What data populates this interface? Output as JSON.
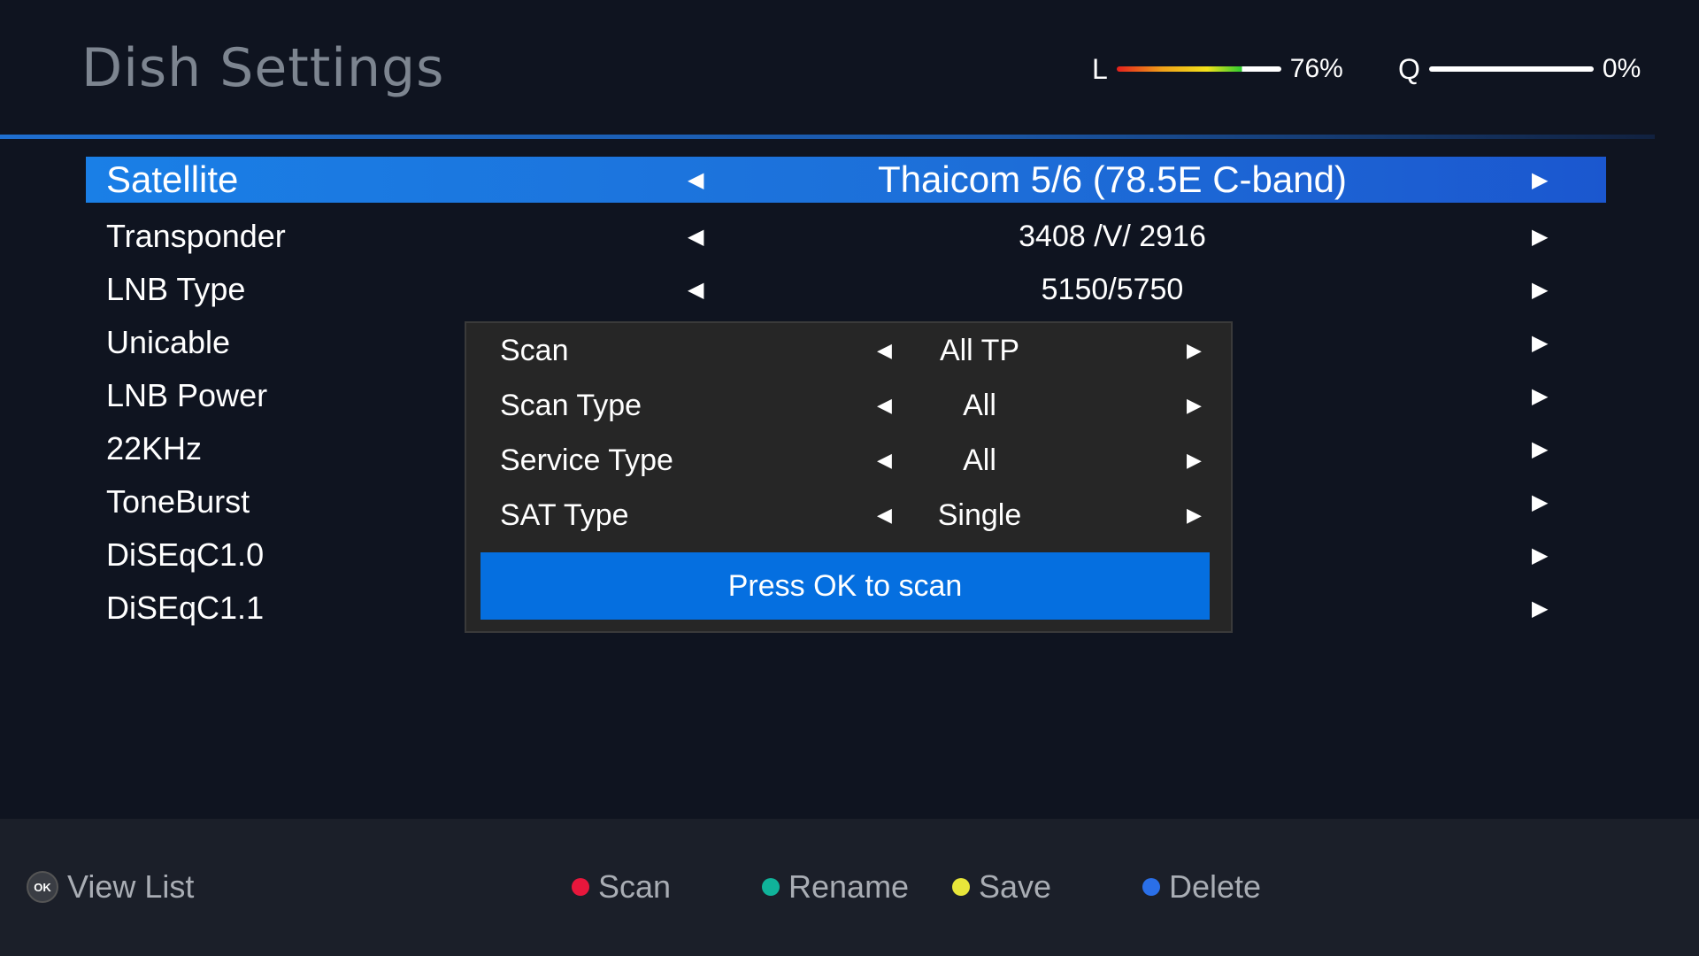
{
  "header": {
    "title": "Dish Settings",
    "level_label": "L",
    "level_value": "76%",
    "quality_label": "Q",
    "quality_value": "0%",
    "level_percent": 76,
    "quality_percent": 0
  },
  "menu": {
    "items": [
      {
        "label": "Satellite",
        "value": "Thaicom 5/6 (78.5E C-band)",
        "selected": true
      },
      {
        "label": "Transponder",
        "value": "3408 /V/ 2916"
      },
      {
        "label": "LNB Type",
        "value": "5150/5750"
      },
      {
        "label": "Unicable",
        "value": ""
      },
      {
        "label": "LNB Power",
        "value": ""
      },
      {
        "label": "22KHz",
        "value": ""
      },
      {
        "label": "ToneBurst",
        "value": ""
      },
      {
        "label": "DiSEqC1.0",
        "value": ""
      },
      {
        "label": "DiSEqC1.1",
        "value": ""
      }
    ]
  },
  "popup": {
    "rows": [
      {
        "label": "Scan",
        "value": "All TP"
      },
      {
        "label": "Scan Type",
        "value": "All"
      },
      {
        "label": "Service Type",
        "value": "All"
      },
      {
        "label": "SAT Type",
        "value": "Single"
      }
    ],
    "button": "Press OK to scan"
  },
  "footer": {
    "ok_icon": "OK",
    "view_list": "View List",
    "scan": "Scan",
    "rename": "Rename",
    "save": "Save",
    "delete": "Delete"
  },
  "colors": {
    "accent": "#1a7fe6",
    "red": "#e8173c",
    "green": "#10b39a",
    "yellow": "#e8e63a",
    "blue": "#2a6fe8"
  },
  "icons": {
    "arrow_left": "◀",
    "arrow_right": "▶"
  }
}
